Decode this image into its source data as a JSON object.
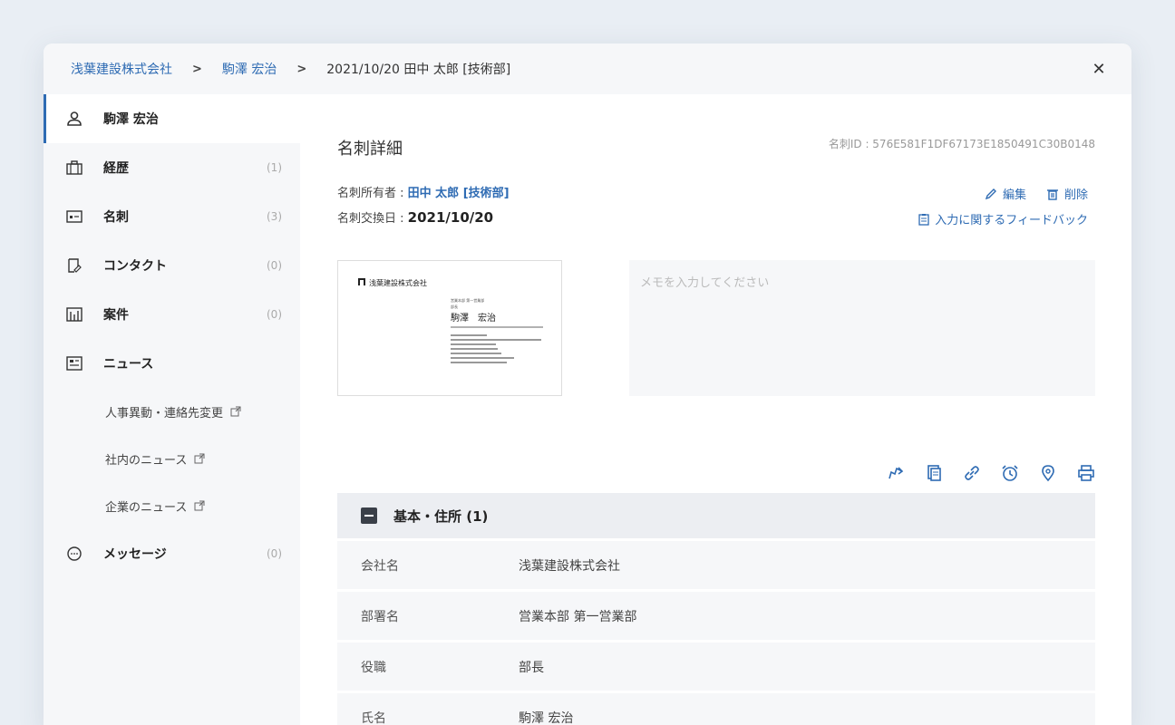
{
  "breadcrumb": {
    "company": "浅葉建設株式会社",
    "person": "駒澤 宏治",
    "current": "2021/10/20 田中 太郎 [技術部]",
    "separator": ">"
  },
  "close_label": "✕",
  "sidebar": {
    "items": [
      {
        "label": "駒澤 宏治",
        "count": "",
        "icon": "person-icon"
      },
      {
        "label": "経歴",
        "count": "(1)",
        "icon": "briefcase-icon"
      },
      {
        "label": "名刺",
        "count": "(3)",
        "icon": "id-card-icon"
      },
      {
        "label": "コンタクト",
        "count": "(0)",
        "icon": "contact-icon"
      },
      {
        "label": "案件",
        "count": "(0)",
        "icon": "chart-icon"
      },
      {
        "label": "ニュース",
        "count": "",
        "icon": "news-icon"
      }
    ],
    "news_sub": [
      "人事異動・連絡先変更",
      "社内のニュース",
      "企業のニュース"
    ],
    "message": {
      "label": "メッセージ",
      "count": "(0)",
      "icon": "chat-icon"
    }
  },
  "main": {
    "title": "名刺詳細",
    "card_id": "名刺ID : 576E581F1DF67173E1850491C30B0148",
    "owner_label": "名刺所有者 : ",
    "owner_name": "田中 太郎 [技術部]",
    "exchange_label": "名刺交換日 : ",
    "exchange_date": "2021/10/20",
    "edit_label": "編集",
    "delete_label": "削除",
    "feedback_label": "入力に関するフィードバック",
    "memo_placeholder": "メモを入力してください",
    "card_image": {
      "company": "浅葉建設株式会社",
      "dept": "営業本部 第一営業部",
      "title": "部長",
      "name": "駒澤　宏治"
    },
    "section_title": "基本・住所 (1)",
    "fields": [
      {
        "label": "会社名",
        "value": "浅葉建設株式会社"
      },
      {
        "label": "部署名",
        "value": "営業本部 第一営業部"
      },
      {
        "label": "役職",
        "value": "部長"
      },
      {
        "label": "氏名",
        "value": "駒澤 宏治"
      }
    ]
  },
  "colors": {
    "accent": "#2e6bb3",
    "sidebar_bg": "#f6f7f9",
    "row_bg": "#f6f7f9"
  }
}
